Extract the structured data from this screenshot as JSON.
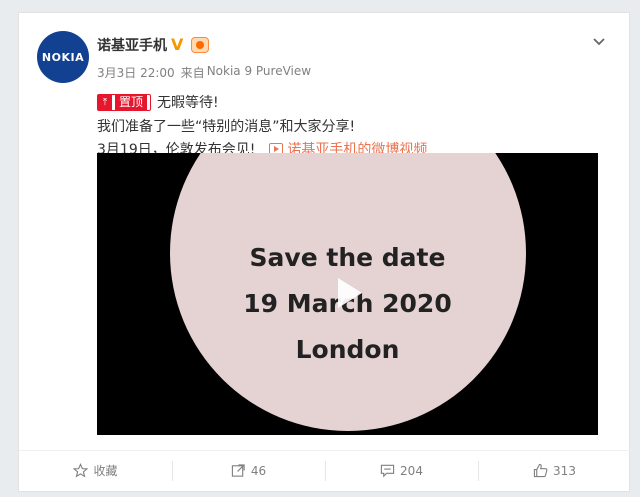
{
  "post": {
    "author": "诺基亚手机",
    "avatar_text": "NOKIA",
    "verified_mark": "V",
    "time": "3月3日 22:00",
    "source_prefix": "来自",
    "source": "Nokia 9 PureView",
    "pinned_label": "置顶",
    "text_line1": "无暇等待!",
    "text_line2": "我们准备了一些“特别的消息”和大家分享!",
    "text_line3": "3月19日，伦敦发布会见!",
    "video_link": "诺基亚手机的微博视频",
    "video": {
      "line1": "Save the date",
      "line2": "19 March 2020",
      "line3": "London"
    }
  },
  "actions": {
    "favorite": "收藏",
    "repost_count": "46",
    "comment_count": "204",
    "like_count": "313"
  },
  "icons": [
    "verified-icon",
    "vip-icon",
    "chevron-down-icon",
    "pin-icon",
    "video-icon",
    "play-icon",
    "star-icon",
    "repost-icon",
    "comment-icon",
    "like-icon"
  ],
  "colors": {
    "brand_blue": "#124191",
    "pin_red": "#e6162d",
    "link_orange": "#eb7350",
    "video_circle": "#e5d2d2"
  }
}
